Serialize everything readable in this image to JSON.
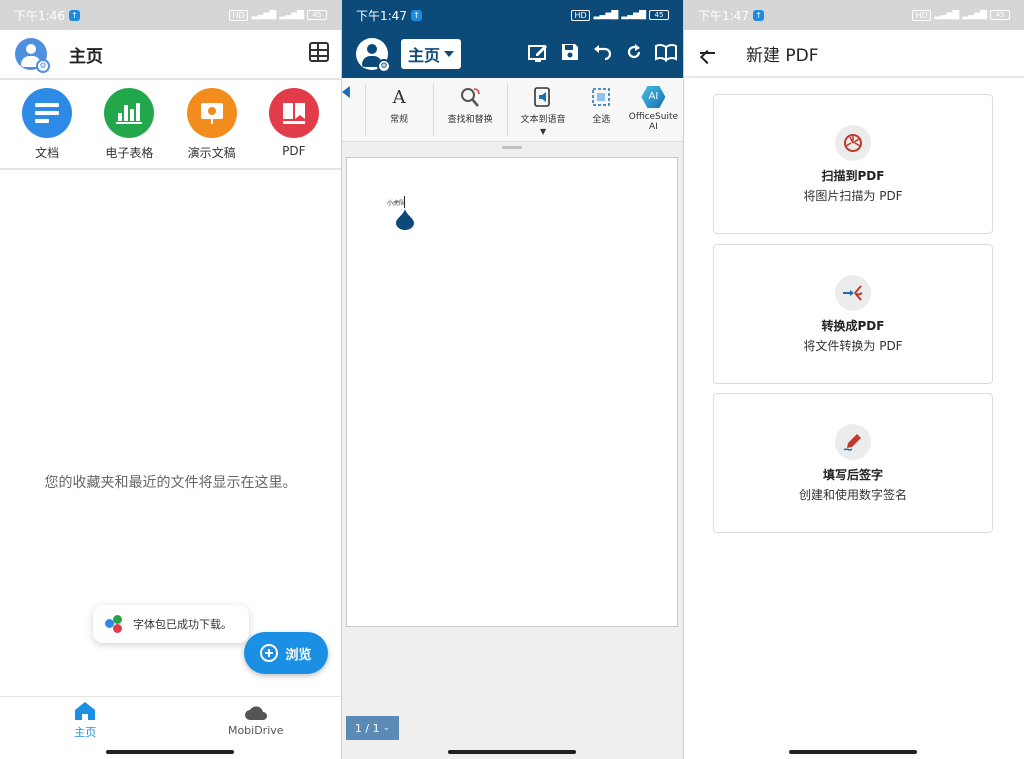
{
  "colors": {
    "accent": "#1a8fe3",
    "toolbar": "#0c4a7a",
    "doc_blue": "#2d8ae5",
    "sheet_green": "#22a84a",
    "slides_orange": "#f28c1c",
    "pdf_red": "#e23b4a"
  },
  "panel1": {
    "status": {
      "time": "下午1:46",
      "battery": "45"
    },
    "header": {
      "title": "主页"
    },
    "apps": [
      {
        "label": "文档",
        "icon": "document-icon"
      },
      {
        "label": "电子表格",
        "icon": "spreadsheet-icon"
      },
      {
        "label": "演示文稿",
        "icon": "presentation-icon"
      },
      {
        "label": "PDF",
        "icon": "pdf-icon"
      }
    ],
    "empty_message": "您的收藏夹和最近的文件将显示在这里。",
    "toast": "字体包已成功下载。",
    "fab_label": "浏览",
    "nav": [
      {
        "label": "主页",
        "icon": "home-icon",
        "active": true
      },
      {
        "label": "MobiDrive",
        "icon": "cloud-icon",
        "active": false
      }
    ]
  },
  "panel2": {
    "status": {
      "time": "下午1:47",
      "battery": "45"
    },
    "home_dropdown": "主页",
    "ribbon": [
      {
        "label": "常规",
        "icon": "font-icon"
      },
      {
        "label": "查找和替换",
        "icon": "find-replace-icon"
      },
      {
        "label": "文本到语音",
        "icon": "text-to-speech-icon"
      },
      {
        "label": "全选",
        "icon": "select-all-icon"
      },
      {
        "label": "OfficeSuite AI",
        "icon": "ai-icon"
      }
    ],
    "ai_badge": "AI",
    "doc_text": "小虎队",
    "page_indicator": "1 / 1"
  },
  "panel3": {
    "status": {
      "time": "下午1:47",
      "battery": "45"
    },
    "title": "新建 PDF",
    "cards": [
      {
        "title": "扫描到PDF",
        "subtitle": "将图片扫描为 PDF",
        "icon": "scan-icon"
      },
      {
        "title": "转换成PDF",
        "subtitle": "将文件转换为 PDF",
        "icon": "convert-icon"
      },
      {
        "title": "填写后签字",
        "subtitle": "创建和使用数字签名",
        "icon": "signature-icon"
      }
    ]
  }
}
